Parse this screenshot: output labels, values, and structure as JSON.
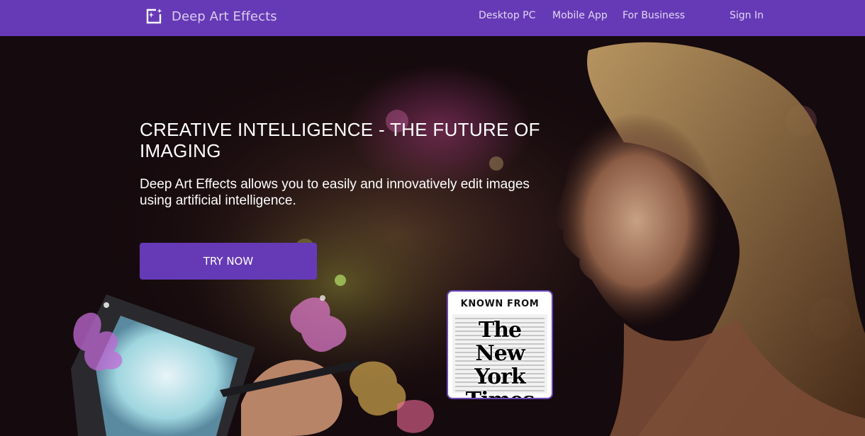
{
  "header": {
    "brand": "Deep Art Effects",
    "nav": [
      "Desktop PC",
      "Mobile App",
      "For Business"
    ],
    "sign_in": "Sign In"
  },
  "hero": {
    "title": "CREATIVE INTELLIGENCE - THE FUTURE OF IMAGING",
    "subtitle": "Deep Art Effects allows you to easily and innovatively edit images using artificial intelligence.",
    "cta": "TRY NOW"
  },
  "badge": {
    "label": "KNOWN FROM",
    "logo_text": "The New York Times"
  },
  "colors": {
    "brand_purple": "#663ab6",
    "hero_dark": "#14080c"
  },
  "icons": {
    "brand": "brand-logo-icon"
  }
}
